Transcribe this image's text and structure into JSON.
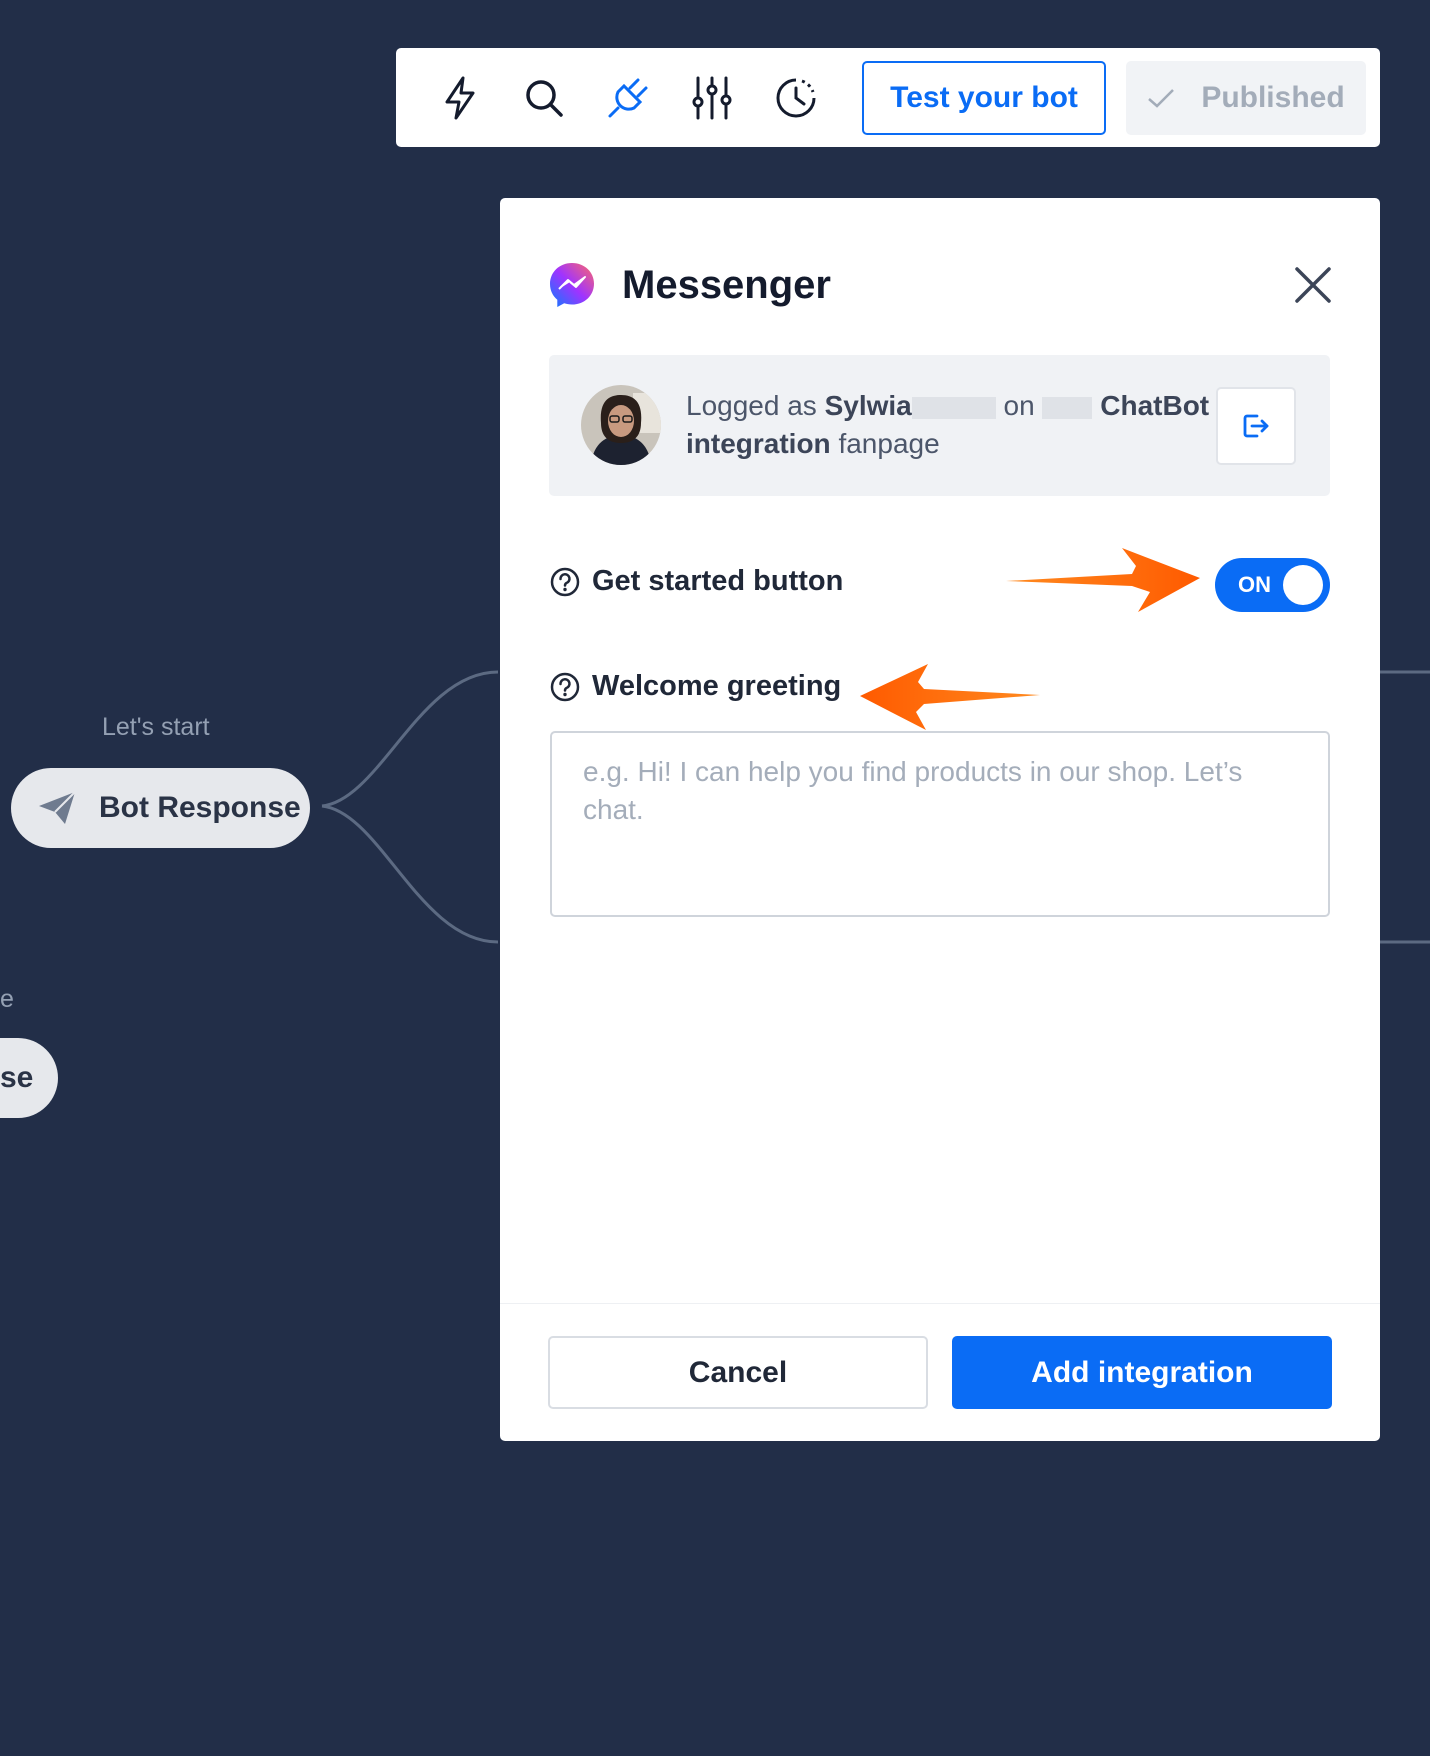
{
  "canvas": {
    "node_label": "Let's start",
    "node_title": "Bot Response",
    "partial_label": "e",
    "partial_title": "se"
  },
  "toolbar": {
    "icons": [
      "lightning-icon",
      "search-icon",
      "plug-icon",
      "sliders-icon",
      "history-icon"
    ],
    "test_label": "Test your bot",
    "published_label": "Published"
  },
  "modal": {
    "title": "Messenger",
    "login": {
      "prefix": "Logged as",
      "user": "Sylwia",
      "on": "on",
      "page_name_1": "ChatBot",
      "page_name_2": "integration",
      "suffix": "fanpage"
    },
    "get_started": {
      "label": "Get started button",
      "toggle_text": "ON"
    },
    "welcome": {
      "label": "Welcome greeting",
      "placeholder": "e.g. Hi! I can help you find products in our shop. Let’s chat."
    },
    "footer": {
      "cancel_label": "Cancel",
      "add_label": "Add integration"
    }
  },
  "colors": {
    "background": "#222e48",
    "accent": "#0a6cf5",
    "annotation_arrow": "#ff6a00"
  }
}
